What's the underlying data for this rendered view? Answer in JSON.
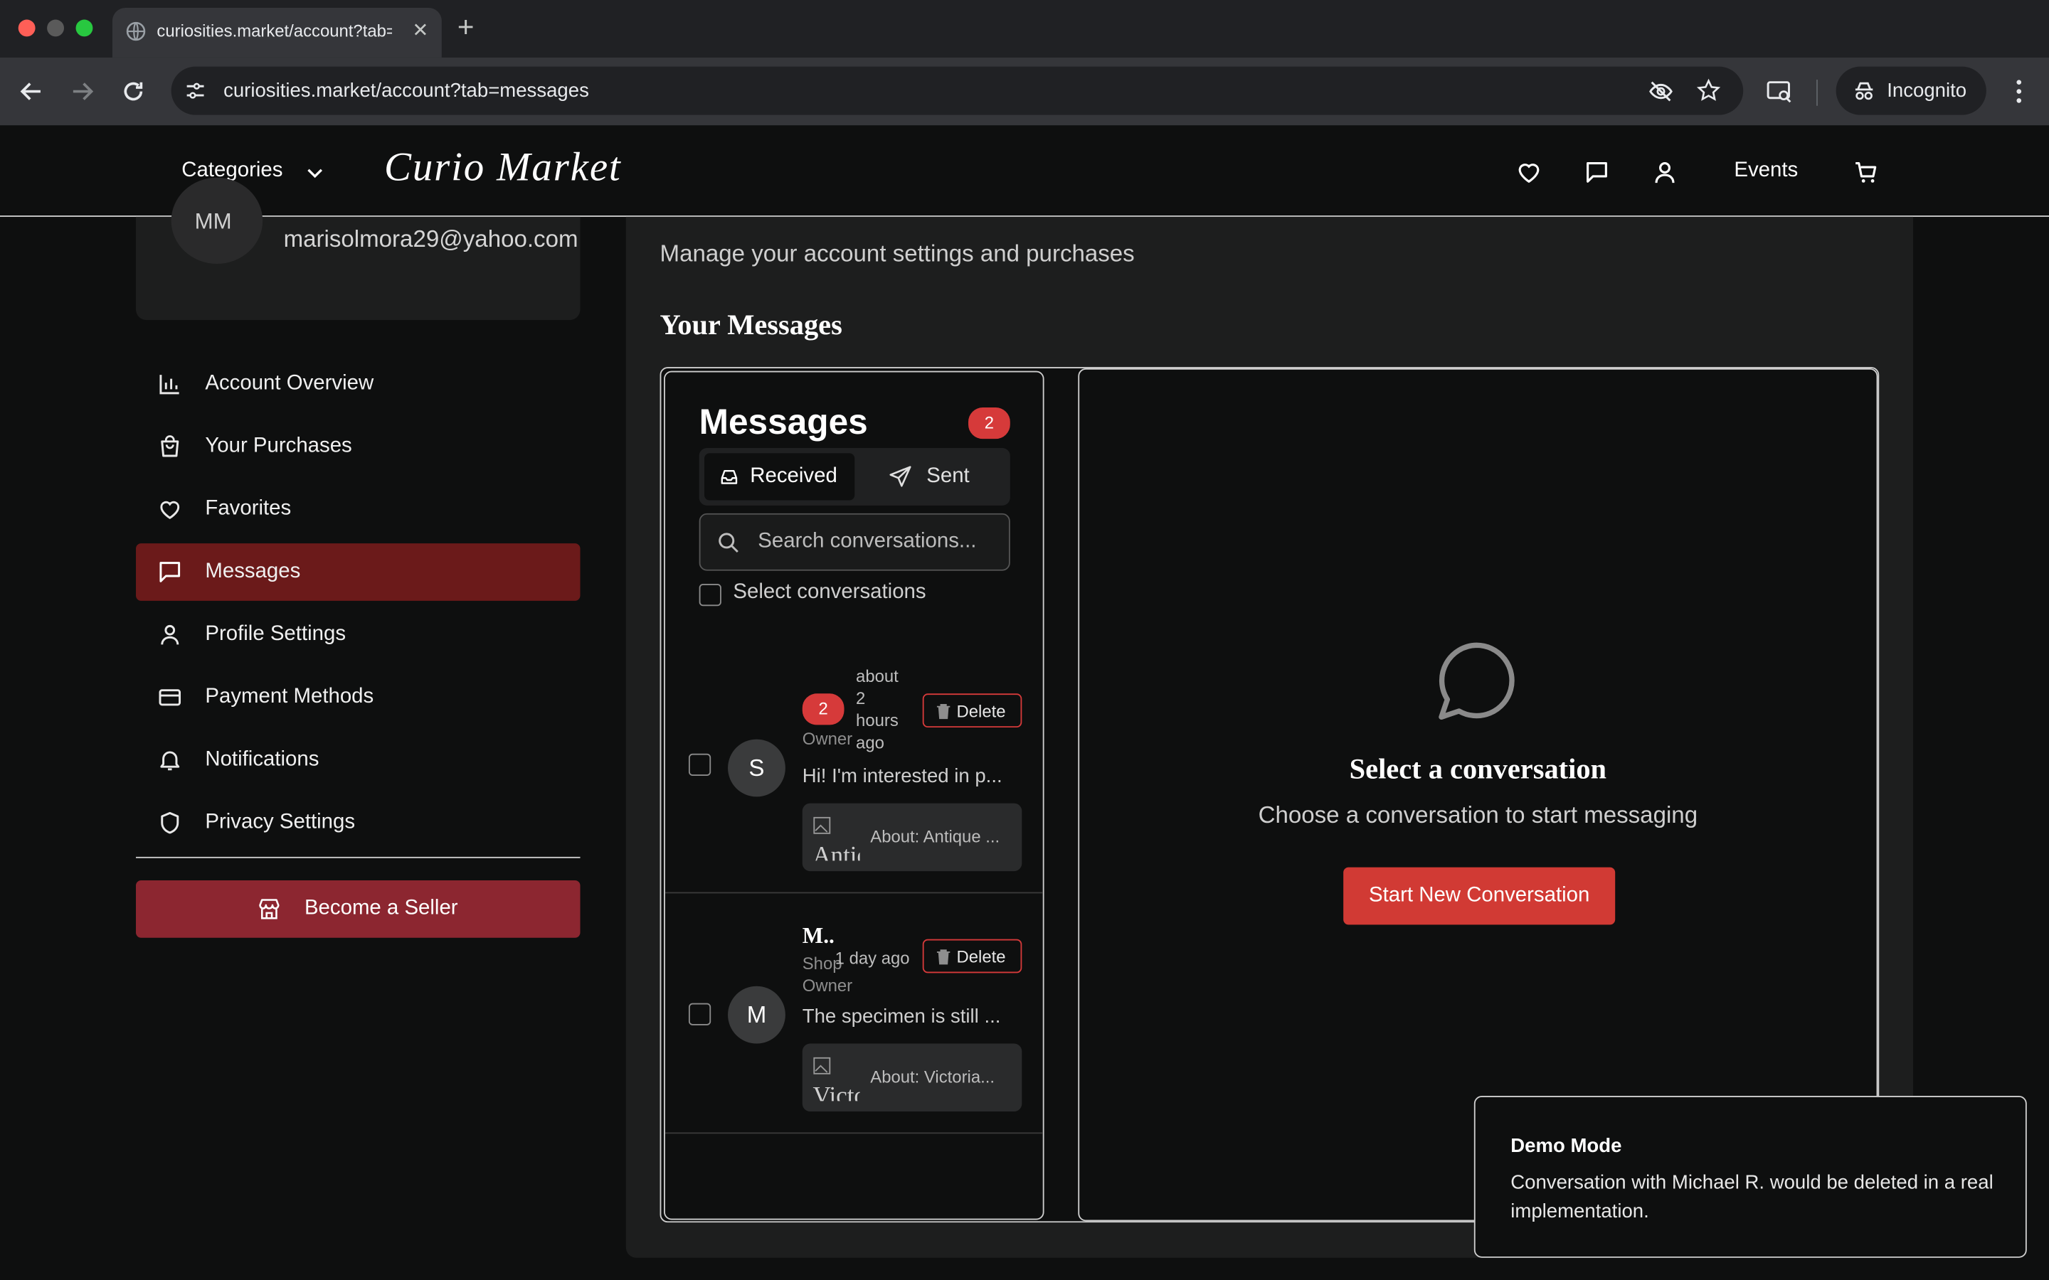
{
  "browser": {
    "tab_title": "curiosities.market/account?tab=messages",
    "url": "curiosities.market/account?tab=messages",
    "incognito_label": "Incognito",
    "traffic_colors": [
      "#ff5f57",
      "#5a5a5a",
      "#28c840"
    ]
  },
  "site_header": {
    "categories_label": "Categories",
    "logo_text": "Curio Market",
    "events_label": "Events",
    "icons": [
      "heart-icon",
      "chat-icon",
      "user-icon",
      "cart-icon"
    ]
  },
  "profile": {
    "initials": "MM",
    "email": "marisolmora29@yahoo.com"
  },
  "sidebar": {
    "items": [
      {
        "label": "Account Overview",
        "icon": "bar-chart-icon",
        "active": false
      },
      {
        "label": "Your Purchases",
        "icon": "shopping-bag-icon",
        "active": false
      },
      {
        "label": "Favorites",
        "icon": "heart-icon",
        "active": false
      },
      {
        "label": "Messages",
        "icon": "chat-icon",
        "active": true
      },
      {
        "label": "Profile Settings",
        "icon": "user-icon",
        "active": false
      },
      {
        "label": "Payment Methods",
        "icon": "credit-card-icon",
        "active": false
      },
      {
        "label": "Notifications",
        "icon": "bell-icon",
        "active": false
      },
      {
        "label": "Privacy Settings",
        "icon": "shield-icon",
        "active": false
      }
    ],
    "seller_button": "Become a Seller"
  },
  "main": {
    "subtitle": "Manage your account settings and purchases",
    "heading": "Your Messages"
  },
  "messages": {
    "title": "Messages",
    "unread_count": "2",
    "tab_received": "Received",
    "tab_sent": "Sent",
    "search_placeholder": "Search conversations...",
    "select_label": "Select conversations",
    "conversations": [
      {
        "initial": "S",
        "unread": "2",
        "time": "about 2 hours ago",
        "role": "Owner",
        "preview": "Hi! I'm interested in p...",
        "image_alt": "Antique",
        "about": "About: Antique ...",
        "delete_label": "Delete"
      },
      {
        "initial": "M",
        "name": "M..",
        "time": "1 day ago",
        "role": "Shop Owner",
        "preview": "The specimen is still ...",
        "image_alt": "Victoria",
        "about": "About: Victoria...",
        "delete_label": "Delete"
      }
    ]
  },
  "empty_state": {
    "title": "Select a conversation",
    "subtitle": "Choose a conversation to start messaging",
    "button": "Start New Conversation"
  },
  "toast": {
    "title": "Demo Mode",
    "body": "Conversation with Michael R. would be deleted in a real implementation."
  },
  "colors": {
    "accent_red": "#d13a34",
    "active_sidebar": "#6b1a1a",
    "seller_button": "#8c2630"
  }
}
